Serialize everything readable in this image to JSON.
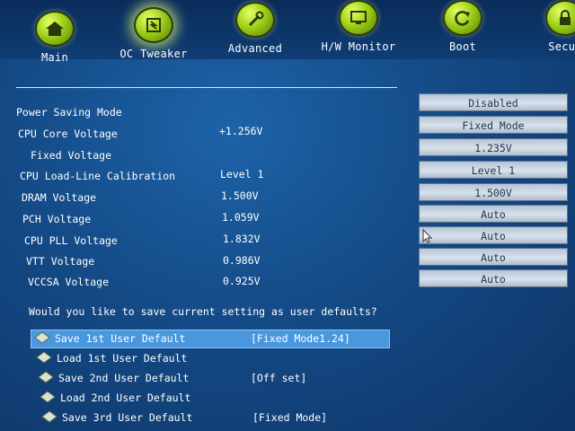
{
  "tabs": [
    {
      "label": "Main",
      "icon": "home-icon"
    },
    {
      "label": "OC Tweaker",
      "icon": "tweaker-icon"
    },
    {
      "label": "Advanced",
      "icon": "wrench-icon"
    },
    {
      "label": "H/W Monitor",
      "icon": "monitor-icon"
    },
    {
      "label": "Boot",
      "icon": "refresh-icon"
    },
    {
      "label": "Secur",
      "icon": "security-icon"
    }
  ],
  "settings": [
    {
      "label": "Power Saving Mode",
      "value": "",
      "option": "Disabled"
    },
    {
      "label": "CPU Core Voltage",
      "value": "+1.256V",
      "option": "Fixed Mode"
    },
    {
      "label": "Fixed Voltage",
      "value": "",
      "option": "1.235V"
    },
    {
      "label": "CPU Load-Line Calibration",
      "value": "Level 1",
      "option": "Level 1"
    },
    {
      "label": "DRAM Voltage",
      "value": "1.500V",
      "option": "1.500V"
    },
    {
      "label": "PCH Voltage",
      "value": "1.059V",
      "option": "Auto"
    },
    {
      "label": "CPU PLL Voltage",
      "value": "1.832V",
      "option": "Auto"
    },
    {
      "label": "VTT Voltage",
      "value": "0.986V",
      "option": "Auto"
    },
    {
      "label": "VCCSA Voltage",
      "value": "0.925V",
      "option": "Auto"
    }
  ],
  "question": "Would you like to save current setting as user defaults?",
  "defaults": [
    {
      "label": "Save 1st User Default",
      "info": "[Fixed Mode1.24]"
    },
    {
      "label": "Load 1st User Default",
      "info": ""
    },
    {
      "label": "Save 2nd User Default",
      "info": "[Off set]"
    },
    {
      "label": "Load 2nd User Default",
      "info": ""
    },
    {
      "label": "Save 3rd User Default",
      "info": "[Fixed Mode]"
    }
  ],
  "colors": {
    "background": "#144a86",
    "accent_selected": "#4a97de",
    "tab_icon": "#9fd018"
  }
}
